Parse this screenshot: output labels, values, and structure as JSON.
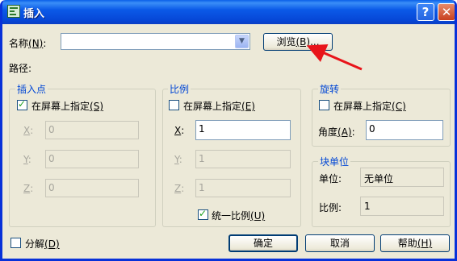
{
  "window": {
    "title": "插入",
    "help_glyph": "?",
    "close_glyph": "✕"
  },
  "name_row": {
    "label": "名称",
    "accel": "(N)",
    "colon": ":",
    "value": "",
    "browse_label": "浏览",
    "browse_accel": "(B)",
    "browse_ellipsis": "..."
  },
  "path_label": "路径:",
  "insertion": {
    "title": "插入点",
    "on_screen_label": "在屏幕上指定",
    "on_screen_accel": "(S)",
    "on_screen_checked": true,
    "x_label": "X",
    "y_label": "Y",
    "z_label": "Z",
    "colon": ":",
    "x": "0",
    "y": "0",
    "z": "0"
  },
  "scale": {
    "title": "比例",
    "on_screen_label": "在屏幕上指定",
    "on_screen_accel": "(E)",
    "on_screen_checked": false,
    "x_label": "X",
    "y_label": "Y",
    "z_label": "Z",
    "colon": ":",
    "x": "1",
    "y": "1",
    "z": "1",
    "uniform_label": "统一比例",
    "uniform_accel": "(U)",
    "uniform_checked": true
  },
  "rotation": {
    "title": "旋转",
    "on_screen_label": "在屏幕上指定",
    "on_screen_accel": "(C)",
    "on_screen_checked": false,
    "angle_label": "角度",
    "angle_accel": "(A)",
    "colon": ":",
    "angle": "0"
  },
  "block_unit": {
    "title": "块单位",
    "unit_label": "单位:",
    "unit_value": "无单位",
    "factor_label": "比例:",
    "factor_value": "1"
  },
  "explode": {
    "label": "分解",
    "accel": "(D)",
    "checked": false
  },
  "buttons": {
    "ok": "确定",
    "cancel": "取消",
    "help": "帮助",
    "help_accel": "(H)"
  },
  "colors": {
    "title_bar": "#0a5fe8",
    "group_title": "#0046d5",
    "annotation_arrow": "#e8141a",
    "face": "#ece9d8"
  }
}
